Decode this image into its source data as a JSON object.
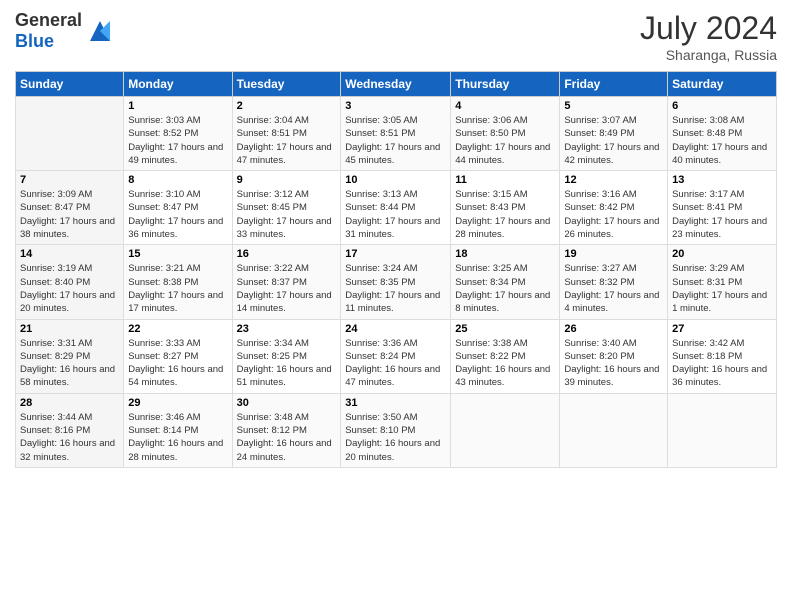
{
  "header": {
    "logo_general": "General",
    "logo_blue": "Blue",
    "month_year": "July 2024",
    "location": "Sharanga, Russia"
  },
  "days_of_week": [
    "Sunday",
    "Monday",
    "Tuesday",
    "Wednesday",
    "Thursday",
    "Friday",
    "Saturday"
  ],
  "weeks": [
    [
      {
        "day": "",
        "sunrise": "",
        "sunset": "",
        "daylight": ""
      },
      {
        "day": "1",
        "sunrise": "Sunrise: 3:03 AM",
        "sunset": "Sunset: 8:52 PM",
        "daylight": "Daylight: 17 hours and 49 minutes."
      },
      {
        "day": "2",
        "sunrise": "Sunrise: 3:04 AM",
        "sunset": "Sunset: 8:51 PM",
        "daylight": "Daylight: 17 hours and 47 minutes."
      },
      {
        "day": "3",
        "sunrise": "Sunrise: 3:05 AM",
        "sunset": "Sunset: 8:51 PM",
        "daylight": "Daylight: 17 hours and 45 minutes."
      },
      {
        "day": "4",
        "sunrise": "Sunrise: 3:06 AM",
        "sunset": "Sunset: 8:50 PM",
        "daylight": "Daylight: 17 hours and 44 minutes."
      },
      {
        "day": "5",
        "sunrise": "Sunrise: 3:07 AM",
        "sunset": "Sunset: 8:49 PM",
        "daylight": "Daylight: 17 hours and 42 minutes."
      },
      {
        "day": "6",
        "sunrise": "Sunrise: 3:08 AM",
        "sunset": "Sunset: 8:48 PM",
        "daylight": "Daylight: 17 hours and 40 minutes."
      }
    ],
    [
      {
        "day": "7",
        "sunrise": "Sunrise: 3:09 AM",
        "sunset": "Sunset: 8:47 PM",
        "daylight": "Daylight: 17 hours and 38 minutes."
      },
      {
        "day": "8",
        "sunrise": "Sunrise: 3:10 AM",
        "sunset": "Sunset: 8:47 PM",
        "daylight": "Daylight: 17 hours and 36 minutes."
      },
      {
        "day": "9",
        "sunrise": "Sunrise: 3:12 AM",
        "sunset": "Sunset: 8:45 PM",
        "daylight": "Daylight: 17 hours and 33 minutes."
      },
      {
        "day": "10",
        "sunrise": "Sunrise: 3:13 AM",
        "sunset": "Sunset: 8:44 PM",
        "daylight": "Daylight: 17 hours and 31 minutes."
      },
      {
        "day": "11",
        "sunrise": "Sunrise: 3:15 AM",
        "sunset": "Sunset: 8:43 PM",
        "daylight": "Daylight: 17 hours and 28 minutes."
      },
      {
        "day": "12",
        "sunrise": "Sunrise: 3:16 AM",
        "sunset": "Sunset: 8:42 PM",
        "daylight": "Daylight: 17 hours and 26 minutes."
      },
      {
        "day": "13",
        "sunrise": "Sunrise: 3:17 AM",
        "sunset": "Sunset: 8:41 PM",
        "daylight": "Daylight: 17 hours and 23 minutes."
      }
    ],
    [
      {
        "day": "14",
        "sunrise": "Sunrise: 3:19 AM",
        "sunset": "Sunset: 8:40 PM",
        "daylight": "Daylight: 17 hours and 20 minutes."
      },
      {
        "day": "15",
        "sunrise": "Sunrise: 3:21 AM",
        "sunset": "Sunset: 8:38 PM",
        "daylight": "Daylight: 17 hours and 17 minutes."
      },
      {
        "day": "16",
        "sunrise": "Sunrise: 3:22 AM",
        "sunset": "Sunset: 8:37 PM",
        "daylight": "Daylight: 17 hours and 14 minutes."
      },
      {
        "day": "17",
        "sunrise": "Sunrise: 3:24 AM",
        "sunset": "Sunset: 8:35 PM",
        "daylight": "Daylight: 17 hours and 11 minutes."
      },
      {
        "day": "18",
        "sunrise": "Sunrise: 3:25 AM",
        "sunset": "Sunset: 8:34 PM",
        "daylight": "Daylight: 17 hours and 8 minutes."
      },
      {
        "day": "19",
        "sunrise": "Sunrise: 3:27 AM",
        "sunset": "Sunset: 8:32 PM",
        "daylight": "Daylight: 17 hours and 4 minutes."
      },
      {
        "day": "20",
        "sunrise": "Sunrise: 3:29 AM",
        "sunset": "Sunset: 8:31 PM",
        "daylight": "Daylight: 17 hours and 1 minute."
      }
    ],
    [
      {
        "day": "21",
        "sunrise": "Sunrise: 3:31 AM",
        "sunset": "Sunset: 8:29 PM",
        "daylight": "Daylight: 16 hours and 58 minutes."
      },
      {
        "day": "22",
        "sunrise": "Sunrise: 3:33 AM",
        "sunset": "Sunset: 8:27 PM",
        "daylight": "Daylight: 16 hours and 54 minutes."
      },
      {
        "day": "23",
        "sunrise": "Sunrise: 3:34 AM",
        "sunset": "Sunset: 8:25 PM",
        "daylight": "Daylight: 16 hours and 51 minutes."
      },
      {
        "day": "24",
        "sunrise": "Sunrise: 3:36 AM",
        "sunset": "Sunset: 8:24 PM",
        "daylight": "Daylight: 16 hours and 47 minutes."
      },
      {
        "day": "25",
        "sunrise": "Sunrise: 3:38 AM",
        "sunset": "Sunset: 8:22 PM",
        "daylight": "Daylight: 16 hours and 43 minutes."
      },
      {
        "day": "26",
        "sunrise": "Sunrise: 3:40 AM",
        "sunset": "Sunset: 8:20 PM",
        "daylight": "Daylight: 16 hours and 39 minutes."
      },
      {
        "day": "27",
        "sunrise": "Sunrise: 3:42 AM",
        "sunset": "Sunset: 8:18 PM",
        "daylight": "Daylight: 16 hours and 36 minutes."
      }
    ],
    [
      {
        "day": "28",
        "sunrise": "Sunrise: 3:44 AM",
        "sunset": "Sunset: 8:16 PM",
        "daylight": "Daylight: 16 hours and 32 minutes."
      },
      {
        "day": "29",
        "sunrise": "Sunrise: 3:46 AM",
        "sunset": "Sunset: 8:14 PM",
        "daylight": "Daylight: 16 hours and 28 minutes."
      },
      {
        "day": "30",
        "sunrise": "Sunrise: 3:48 AM",
        "sunset": "Sunset: 8:12 PM",
        "daylight": "Daylight: 16 hours and 24 minutes."
      },
      {
        "day": "31",
        "sunrise": "Sunrise: 3:50 AM",
        "sunset": "Sunset: 8:10 PM",
        "daylight": "Daylight: 16 hours and 20 minutes."
      },
      {
        "day": "",
        "sunrise": "",
        "sunset": "",
        "daylight": ""
      },
      {
        "day": "",
        "sunrise": "",
        "sunset": "",
        "daylight": ""
      },
      {
        "day": "",
        "sunrise": "",
        "sunset": "",
        "daylight": ""
      }
    ]
  ]
}
